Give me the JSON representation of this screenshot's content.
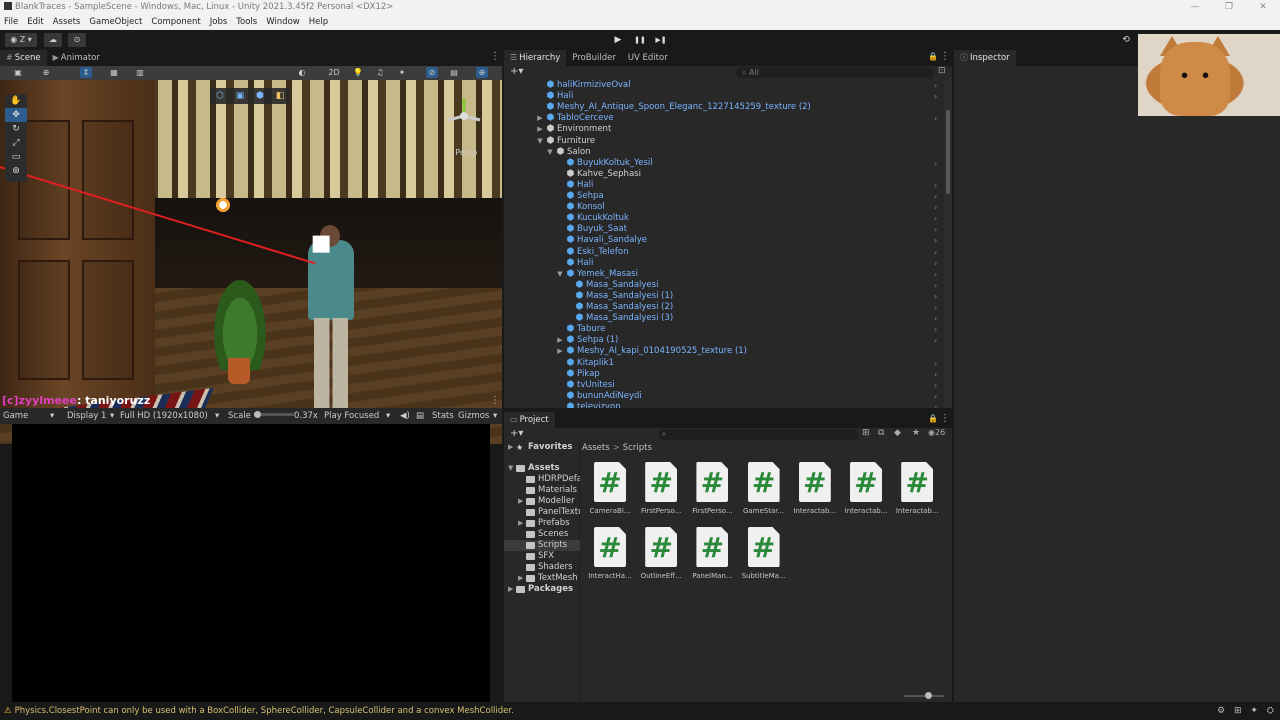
{
  "window": {
    "title": "BlankTraces - SampleScene - Windows, Mac, Linux - Unity 2021.3.45f2 Personal <DX12>",
    "controls": [
      "—",
      "❐",
      "✕"
    ]
  },
  "menu": [
    "File",
    "Edit",
    "Assets",
    "GameObject",
    "Component",
    "Jobs",
    "Tools",
    "Window",
    "Help"
  ],
  "toolbar": {
    "account_label": "Z",
    "play": "▶",
    "pause": "❚❚",
    "step": "▶❚",
    "history": "⟲"
  },
  "scene_panel": {
    "tabs": [
      "Scene",
      "Animator"
    ],
    "toolbar_2d": "2D",
    "persp_label": "< Persp"
  },
  "chat": {
    "username": "[c]zyylmeee",
    "message": ": taniyoruzz"
  },
  "game_panel": {
    "tab": "Game",
    "display": "Display 1",
    "resolution": "Full HD (1920x1080)",
    "scale_label": "Scale",
    "scale_value": "0.37x",
    "play_mode": "Play Focused",
    "stats": "Stats",
    "gizmos": "Gizmos"
  },
  "hierarchy": {
    "tabs": [
      "Hierarchy",
      "ProBuilder",
      "UV Editor"
    ],
    "search_placeholder": "All",
    "rows": [
      {
        "label": "haliKirmiziveOval",
        "depth": 3,
        "blue": true,
        "arrow": "",
        "chev": true
      },
      {
        "label": "Hali",
        "depth": 3,
        "blue": true,
        "arrow": "",
        "chev": true
      },
      {
        "label": "Meshy_AI_Antique_Spoon_Eleganc_1227145259_texture (2)",
        "depth": 3,
        "blue": true,
        "arrow": "",
        "chev": false
      },
      {
        "label": "TabloCerceve",
        "depth": 3,
        "blue": true,
        "arrow": "▶",
        "chev": true
      },
      {
        "label": "Environment",
        "depth": 3,
        "blue": false,
        "arrow": "▶",
        "chev": false
      },
      {
        "label": "Furniture",
        "depth": 3,
        "blue": false,
        "arrow": "▼",
        "chev": false
      },
      {
        "label": "Salon",
        "depth": 4,
        "blue": false,
        "arrow": "▼",
        "chev": false
      },
      {
        "label": "BuyukKoltuk_Yesil",
        "depth": 5,
        "blue": true,
        "arrow": "",
        "chev": true
      },
      {
        "label": "Kahve_Sephasi",
        "depth": 5,
        "blue": false,
        "arrow": "",
        "chev": false
      },
      {
        "label": "Hali",
        "depth": 5,
        "blue": true,
        "arrow": "",
        "chev": true
      },
      {
        "label": "Sehpa",
        "depth": 5,
        "blue": true,
        "arrow": "",
        "chev": true
      },
      {
        "label": "Konsol",
        "depth": 5,
        "blue": true,
        "arrow": "",
        "chev": true
      },
      {
        "label": "KucukKoltuk",
        "depth": 5,
        "blue": true,
        "arrow": "",
        "chev": true
      },
      {
        "label": "Buyuk_Saat",
        "depth": 5,
        "blue": true,
        "arrow": "",
        "chev": true
      },
      {
        "label": "Havali_Sandalye",
        "depth": 5,
        "blue": true,
        "arrow": "",
        "chev": true
      },
      {
        "label": "Eski_Telefon",
        "depth": 5,
        "blue": true,
        "arrow": "",
        "chev": true
      },
      {
        "label": "Hali",
        "depth": 5,
        "blue": true,
        "arrow": "",
        "chev": true
      },
      {
        "label": "Yemek_Masasi",
        "depth": 5,
        "blue": true,
        "arrow": "▼",
        "chev": true
      },
      {
        "label": "Masa_Sandalyesi",
        "depth": 6,
        "blue": true,
        "arrow": "",
        "chev": true
      },
      {
        "label": "Masa_Sandalyesi (1)",
        "depth": 6,
        "blue": true,
        "arrow": "",
        "chev": true
      },
      {
        "label": "Masa_Sandalyesi (2)",
        "depth": 6,
        "blue": true,
        "arrow": "",
        "chev": true
      },
      {
        "label": "Masa_Sandalyesi (3)",
        "depth": 6,
        "blue": true,
        "arrow": "",
        "chev": true
      },
      {
        "label": "Tabure",
        "depth": 5,
        "blue": true,
        "arrow": "",
        "chev": true
      },
      {
        "label": "Sehpa (1)",
        "depth": 5,
        "blue": true,
        "arrow": "▶",
        "chev": true
      },
      {
        "label": "Meshy_AI_kapi_0104190525_texture (1)",
        "depth": 5,
        "blue": true,
        "arrow": "▶",
        "chev": false
      },
      {
        "label": "Kitaplik1",
        "depth": 5,
        "blue": true,
        "arrow": "",
        "chev": true
      },
      {
        "label": "Pikap",
        "depth": 5,
        "blue": true,
        "arrow": "",
        "chev": true
      },
      {
        "label": "tvUnitesi",
        "depth": 5,
        "blue": true,
        "arrow": "",
        "chev": true
      },
      {
        "label": "bununAdiNeydi",
        "depth": 5,
        "blue": true,
        "arrow": "",
        "chev": true
      },
      {
        "label": "televizyon",
        "depth": 5,
        "blue": true,
        "arrow": "",
        "chev": true
      }
    ]
  },
  "project": {
    "tab": "Project",
    "count": "26",
    "tree": [
      {
        "label": "Favorites",
        "level": 0,
        "head": true,
        "arrow": "▶",
        "folder": false,
        "star": true
      },
      {
        "label": "Assets",
        "level": 0,
        "head": true,
        "arrow": "▼",
        "folder": true
      },
      {
        "label": "HDRPDefault",
        "level": 1,
        "arrow": "",
        "folder": true
      },
      {
        "label": "Materials",
        "level": 1,
        "arrow": "",
        "folder": true
      },
      {
        "label": "Modeller",
        "level": 1,
        "arrow": "▶",
        "folder": true
      },
      {
        "label": "PanelTextures",
        "level": 1,
        "arrow": "",
        "folder": true
      },
      {
        "label": "Prefabs",
        "level": 1,
        "arrow": "▶",
        "folder": true
      },
      {
        "label": "Scenes",
        "level": 1,
        "arrow": "",
        "folder": true
      },
      {
        "label": "Scripts",
        "level": 1,
        "arrow": "",
        "folder": true,
        "selected": true
      },
      {
        "label": "SFX",
        "level": 1,
        "arrow": "",
        "folder": true
      },
      {
        "label": "Shaders",
        "level": 1,
        "arrow": "",
        "folder": true
      },
      {
        "label": "TextMesh Pro",
        "level": 1,
        "arrow": "▶",
        "folder": true
      },
      {
        "label": "Packages",
        "level": 0,
        "head": true,
        "arrow": "▶",
        "folder": true
      }
    ],
    "breadcrumb": [
      "Assets",
      "Scripts"
    ],
    "assets": [
      "CameraBl...",
      "FirstPerso...",
      "FirstPerso...",
      "GameStar...",
      "Interactab...",
      "Interactab...",
      "Interactab...",
      "InteractHa...",
      "OutlineEff...",
      "PanelMan...",
      "SubtitleMa..."
    ],
    "asset_glyph": "#"
  },
  "inspector": {
    "tab": "Inspector"
  },
  "status": {
    "message": "Physics.ClosestPoint can only be used with a BoxCollider, SphereCollider, CapsuleCollider and a convex MeshCollider."
  },
  "colors": {
    "accent_blue": "#7ab4ff",
    "warning": "#f0c020",
    "script_green": "#2a8a3a"
  }
}
